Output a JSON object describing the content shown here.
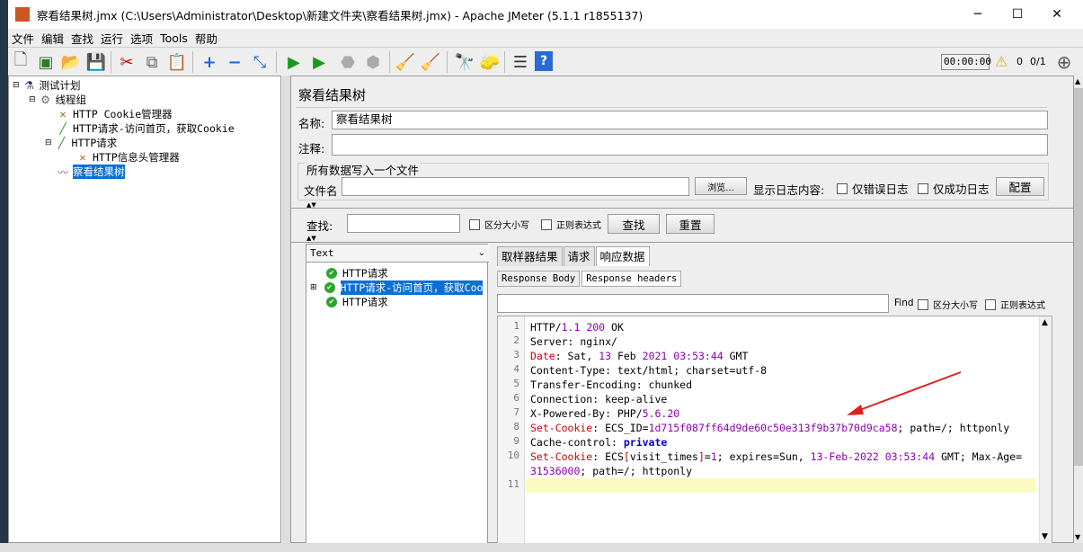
{
  "window": {
    "title": "察看结果树.jmx (C:\\Users\\Administrator\\Desktop\\新建文件夹\\察看结果树.jmx) - Apache JMeter (5.1.1 r1855137)",
    "minimize": "─",
    "maximize": "☐",
    "close": "✕"
  },
  "menu": [
    "文件",
    "编辑",
    "查找",
    "运行",
    "选项",
    "Tools",
    "帮助"
  ],
  "toolbar": {
    "timer": "00:00:00",
    "warning_count": "0",
    "threads": "0/1"
  },
  "tree": {
    "items": [
      {
        "label": "测试计划",
        "icon": "test-plan-icon"
      },
      {
        "label": "线程组",
        "icon": "gear-icon"
      },
      {
        "label": "HTTP Cookie管理器",
        "icon": "wrench-icon"
      },
      {
        "label": "HTTP请求-访问首页，获取Cookie",
        "icon": "pipette-icon"
      },
      {
        "label": "HTTP请求",
        "icon": "pipette-icon"
      },
      {
        "label": "HTTP信息头管理器",
        "icon": "wrench-icon"
      },
      {
        "label": "察看结果树",
        "icon": "chart-icon"
      }
    ]
  },
  "panel": {
    "title": "察看结果树",
    "name_label": "名称:",
    "name_value": "察看结果树",
    "comment_label": "注释:",
    "comment_value": "",
    "file_group_title": "所有数据写入一个文件",
    "filename_label": "文件名",
    "filename_value": "",
    "browse_button": "浏览...",
    "log_content_label": "显示日志内容:",
    "errors_only": "仅错误日志",
    "success_only": "仅成功日志",
    "configure_button": "配置",
    "search_label": "查找:",
    "search_value": "",
    "case_sensitive": "区分大小写",
    "regex": "正则表达式",
    "search_button": "查找",
    "reset_button": "重置"
  },
  "results": {
    "renderer": "Text",
    "items": [
      {
        "label": "HTTP请求",
        "status": "ok"
      },
      {
        "label": "HTTP请求-访问首页，获取Coo",
        "status": "ok"
      },
      {
        "label": "HTTP请求",
        "status": "ok"
      }
    ]
  },
  "detail": {
    "tabs": [
      "取样器结果",
      "请求",
      "响应数据"
    ],
    "active_tab": "响应数据",
    "subtabs": [
      "Response Body",
      "Response headers"
    ],
    "active_subtab": "Response headers",
    "find_label": "Find",
    "find_case": "区分大小写",
    "find_regex": "正则表达式",
    "find_value": "",
    "lines": [
      "HTTP/1.1 200 OK",
      "Server: nginx/",
      "Date: Sat, 13 Feb 2021 03:53:44 GMT",
      "Content-Type: text/html; charset=utf-8",
      "Transfer-Encoding: chunked",
      "Connection: keep-alive",
      "X-Powered-By: PHP/5.6.20",
      "Set-Cookie: ECS_ID=1d715f087ff64d9de60c50e313f9b37b70d9ca58; path=/; httponly",
      "Cache-control: private",
      "Set-Cookie: ECS[visit_times]=1; expires=Sun, 13-Feb-2022 03:53:44 GMT; Max-Age=",
      "31536000; path=/; httponly",
      ""
    ],
    "line_numbers": [
      "1",
      "2",
      "3",
      "4",
      "5",
      "6",
      "7",
      "8",
      "9",
      "10",
      "",
      "11"
    ]
  }
}
